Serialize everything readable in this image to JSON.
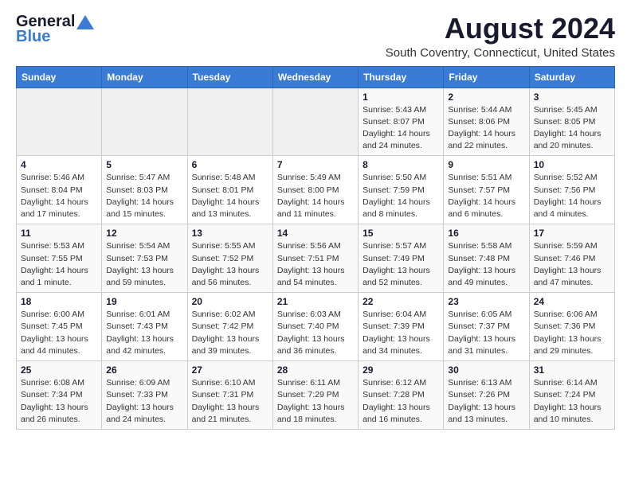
{
  "header": {
    "logo_line1": "General",
    "logo_line2": "Blue",
    "month_title": "August 2024",
    "subtitle": "South Coventry, Connecticut, United States"
  },
  "weekdays": [
    "Sunday",
    "Monday",
    "Tuesday",
    "Wednesday",
    "Thursday",
    "Friday",
    "Saturday"
  ],
  "weeks": [
    [
      {
        "day": "",
        "info": ""
      },
      {
        "day": "",
        "info": ""
      },
      {
        "day": "",
        "info": ""
      },
      {
        "day": "",
        "info": ""
      },
      {
        "day": "1",
        "info": "Sunrise: 5:43 AM\nSunset: 8:07 PM\nDaylight: 14 hours\nand 24 minutes."
      },
      {
        "day": "2",
        "info": "Sunrise: 5:44 AM\nSunset: 8:06 PM\nDaylight: 14 hours\nand 22 minutes."
      },
      {
        "day": "3",
        "info": "Sunrise: 5:45 AM\nSunset: 8:05 PM\nDaylight: 14 hours\nand 20 minutes."
      }
    ],
    [
      {
        "day": "4",
        "info": "Sunrise: 5:46 AM\nSunset: 8:04 PM\nDaylight: 14 hours\nand 17 minutes."
      },
      {
        "day": "5",
        "info": "Sunrise: 5:47 AM\nSunset: 8:03 PM\nDaylight: 14 hours\nand 15 minutes."
      },
      {
        "day": "6",
        "info": "Sunrise: 5:48 AM\nSunset: 8:01 PM\nDaylight: 14 hours\nand 13 minutes."
      },
      {
        "day": "7",
        "info": "Sunrise: 5:49 AM\nSunset: 8:00 PM\nDaylight: 14 hours\nand 11 minutes."
      },
      {
        "day": "8",
        "info": "Sunrise: 5:50 AM\nSunset: 7:59 PM\nDaylight: 14 hours\nand 8 minutes."
      },
      {
        "day": "9",
        "info": "Sunrise: 5:51 AM\nSunset: 7:57 PM\nDaylight: 14 hours\nand 6 minutes."
      },
      {
        "day": "10",
        "info": "Sunrise: 5:52 AM\nSunset: 7:56 PM\nDaylight: 14 hours\nand 4 minutes."
      }
    ],
    [
      {
        "day": "11",
        "info": "Sunrise: 5:53 AM\nSunset: 7:55 PM\nDaylight: 14 hours\nand 1 minute."
      },
      {
        "day": "12",
        "info": "Sunrise: 5:54 AM\nSunset: 7:53 PM\nDaylight: 13 hours\nand 59 minutes."
      },
      {
        "day": "13",
        "info": "Sunrise: 5:55 AM\nSunset: 7:52 PM\nDaylight: 13 hours\nand 56 minutes."
      },
      {
        "day": "14",
        "info": "Sunrise: 5:56 AM\nSunset: 7:51 PM\nDaylight: 13 hours\nand 54 minutes."
      },
      {
        "day": "15",
        "info": "Sunrise: 5:57 AM\nSunset: 7:49 PM\nDaylight: 13 hours\nand 52 minutes."
      },
      {
        "day": "16",
        "info": "Sunrise: 5:58 AM\nSunset: 7:48 PM\nDaylight: 13 hours\nand 49 minutes."
      },
      {
        "day": "17",
        "info": "Sunrise: 5:59 AM\nSunset: 7:46 PM\nDaylight: 13 hours\nand 47 minutes."
      }
    ],
    [
      {
        "day": "18",
        "info": "Sunrise: 6:00 AM\nSunset: 7:45 PM\nDaylight: 13 hours\nand 44 minutes."
      },
      {
        "day": "19",
        "info": "Sunrise: 6:01 AM\nSunset: 7:43 PM\nDaylight: 13 hours\nand 42 minutes."
      },
      {
        "day": "20",
        "info": "Sunrise: 6:02 AM\nSunset: 7:42 PM\nDaylight: 13 hours\nand 39 minutes."
      },
      {
        "day": "21",
        "info": "Sunrise: 6:03 AM\nSunset: 7:40 PM\nDaylight: 13 hours\nand 36 minutes."
      },
      {
        "day": "22",
        "info": "Sunrise: 6:04 AM\nSunset: 7:39 PM\nDaylight: 13 hours\nand 34 minutes."
      },
      {
        "day": "23",
        "info": "Sunrise: 6:05 AM\nSunset: 7:37 PM\nDaylight: 13 hours\nand 31 minutes."
      },
      {
        "day": "24",
        "info": "Sunrise: 6:06 AM\nSunset: 7:36 PM\nDaylight: 13 hours\nand 29 minutes."
      }
    ],
    [
      {
        "day": "25",
        "info": "Sunrise: 6:08 AM\nSunset: 7:34 PM\nDaylight: 13 hours\nand 26 minutes."
      },
      {
        "day": "26",
        "info": "Sunrise: 6:09 AM\nSunset: 7:33 PM\nDaylight: 13 hours\nand 24 minutes."
      },
      {
        "day": "27",
        "info": "Sunrise: 6:10 AM\nSunset: 7:31 PM\nDaylight: 13 hours\nand 21 minutes."
      },
      {
        "day": "28",
        "info": "Sunrise: 6:11 AM\nSunset: 7:29 PM\nDaylight: 13 hours\nand 18 minutes."
      },
      {
        "day": "29",
        "info": "Sunrise: 6:12 AM\nSunset: 7:28 PM\nDaylight: 13 hours\nand 16 minutes."
      },
      {
        "day": "30",
        "info": "Sunrise: 6:13 AM\nSunset: 7:26 PM\nDaylight: 13 hours\nand 13 minutes."
      },
      {
        "day": "31",
        "info": "Sunrise: 6:14 AM\nSunset: 7:24 PM\nDaylight: 13 hours\nand 10 minutes."
      }
    ]
  ]
}
